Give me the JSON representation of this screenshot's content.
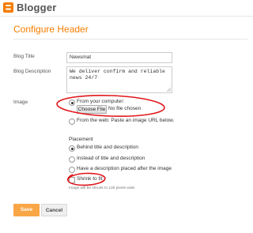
{
  "header": {
    "brand": "Blogger"
  },
  "page": {
    "title": "Configure Header"
  },
  "form": {
    "blog_title_label": "Blog Title",
    "blog_title_value": "Newsmat",
    "blog_description_label": "Blog Description",
    "blog_description_value": "We deliver confirm and reliable news 24/7",
    "image_label": "Image",
    "image_from_computer_label": "From your computer:",
    "choose_file_label": "Choose File",
    "no_file_label": "No file chosen",
    "image_from_web_label": "From the web: Paste an image URL below.",
    "placement_label": "Placement",
    "placement_options": [
      {
        "label": "Behind title and description",
        "selected": true
      },
      {
        "label": "Instead of title and description",
        "selected": false
      },
      {
        "label": "Have a description placed after the image",
        "selected": false
      }
    ],
    "shrink_label": "Shrink to fit",
    "shrink_hint": "Image will be shrunk to 135 pixels wide."
  },
  "actions": {
    "save_label": "Save",
    "cancel_label": "Cancel"
  },
  "colors": {
    "accent": "#f57d00",
    "annotation": "#e0181b",
    "save_bg": "#f9a646"
  }
}
